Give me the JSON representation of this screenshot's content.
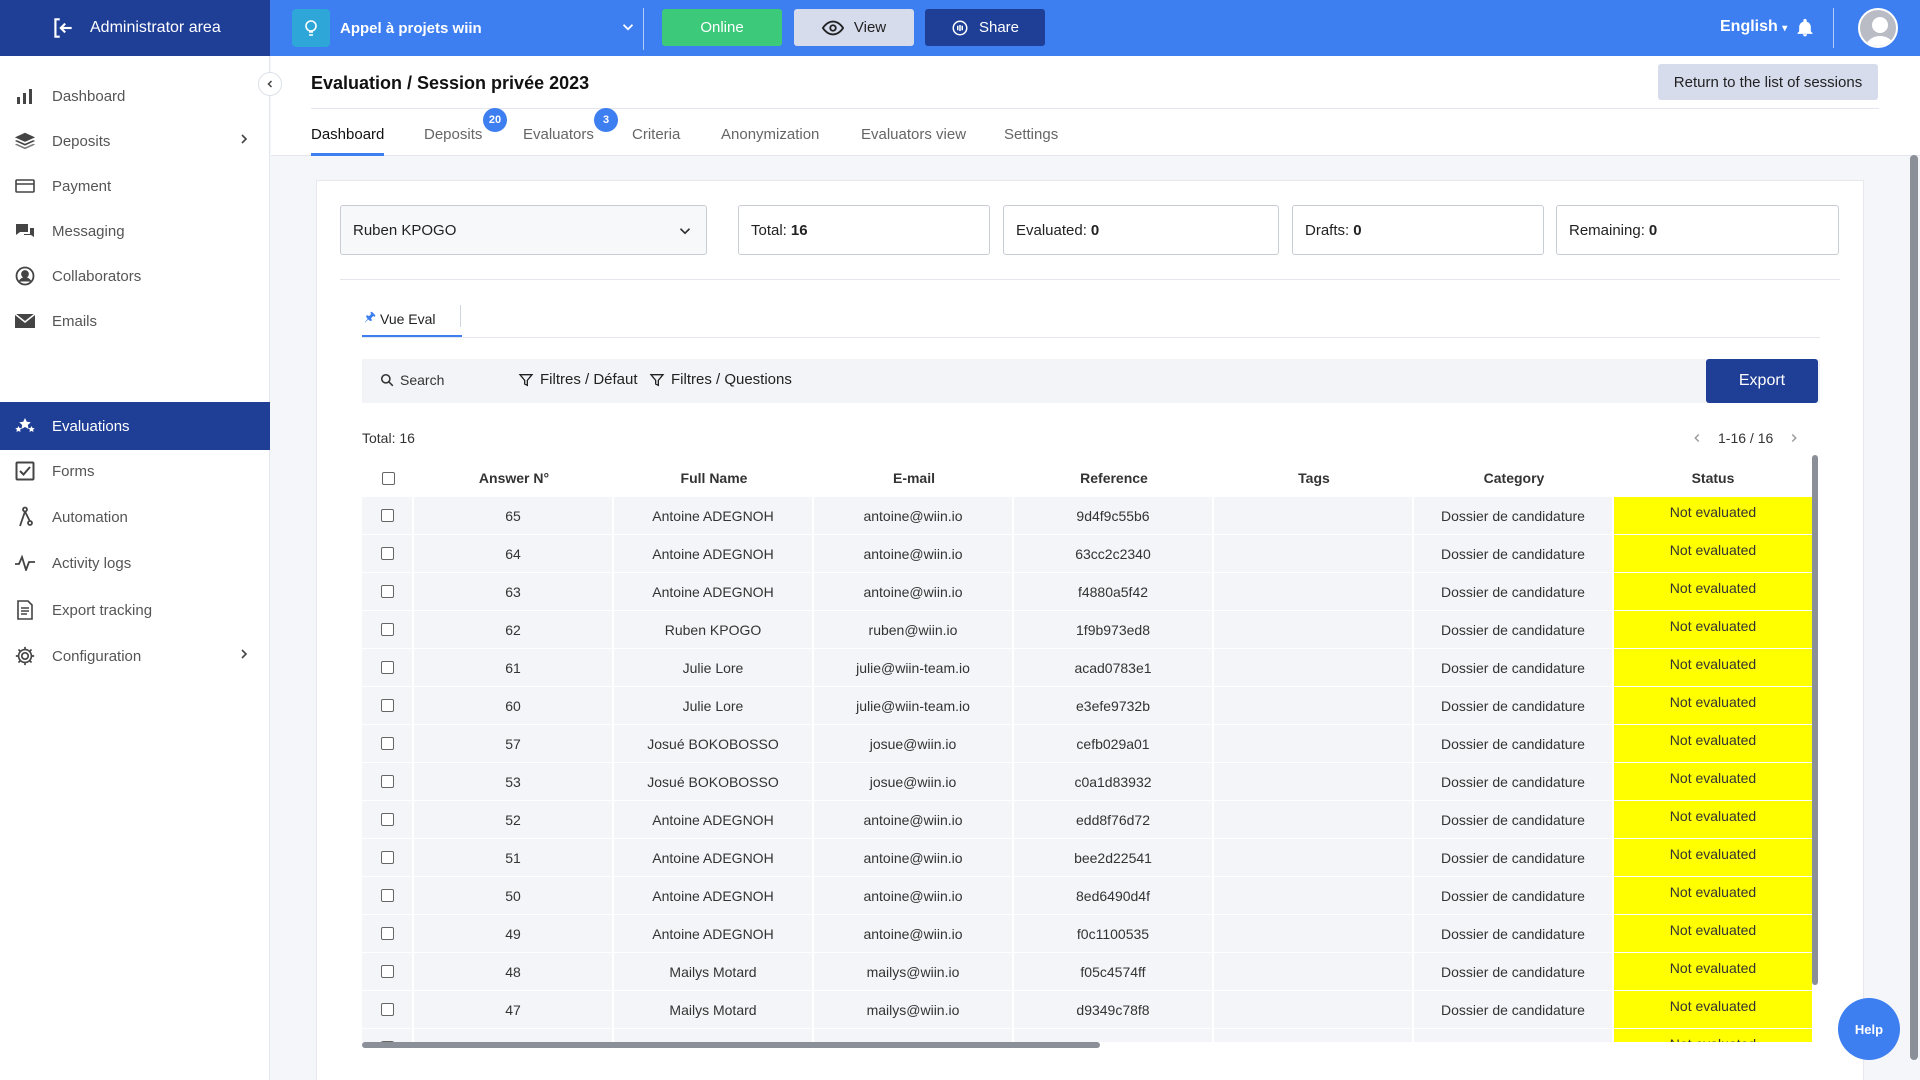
{
  "topbar": {
    "admin_label": "Administrator area",
    "project_name": "Appel à projets wiin",
    "online_label": "Online",
    "view_label": "View",
    "share_label": "Share",
    "language": "English",
    "brand_color": "#3d7ef0",
    "dark_color": "#1f3f96"
  },
  "sidebar": {
    "items": [
      {
        "label": "Dashboard",
        "icon": "bar-chart-icon"
      },
      {
        "label": "Deposits",
        "icon": "layers-icon"
      },
      {
        "label": "Payment",
        "icon": "card-icon"
      },
      {
        "label": "Messaging",
        "icon": "chat-icon"
      },
      {
        "label": "Collaborators",
        "icon": "user-circle-icon"
      },
      {
        "label": "Emails",
        "icon": "envelope-icon"
      },
      {
        "label": "Evaluations",
        "icon": "stars-icon"
      },
      {
        "label": "Forms",
        "icon": "checkbox-icon"
      },
      {
        "label": "Automation",
        "icon": "automation-icon"
      },
      {
        "label": "Activity logs",
        "icon": "pulse-icon"
      },
      {
        "label": "Export tracking",
        "icon": "document-icon"
      },
      {
        "label": "Configuration",
        "icon": "gear-icon"
      }
    ]
  },
  "header": {
    "title": "Evaluation / Session privée 2023",
    "return_label": "Return to the list of sessions",
    "tabs": [
      {
        "label": "Dashboard"
      },
      {
        "label": "Deposits",
        "badge": "20"
      },
      {
        "label": "Evaluators",
        "badge": "3"
      },
      {
        "label": "Criteria"
      },
      {
        "label": "Anonymization"
      },
      {
        "label": "Evaluators view"
      },
      {
        "label": "Settings"
      }
    ]
  },
  "filters": {
    "evaluator": "Ruben KPOGO",
    "stats": [
      {
        "label": "Total:",
        "value": "16"
      },
      {
        "label": "Evaluated:",
        "value": "0"
      },
      {
        "label": "Drafts:",
        "value": "0"
      },
      {
        "label": "Remaining:",
        "value": "0"
      }
    ]
  },
  "subtab": {
    "label": "Vue Eval"
  },
  "toolbar": {
    "search_label": "Search",
    "filter_default": "Filtres / Défaut",
    "filter_questions": "Filtres / Questions",
    "export_label": "Export"
  },
  "list": {
    "total_label": "Total: 16",
    "pager": "1-16 / 16",
    "columns": [
      "Answer N°",
      "Full Name",
      "E-mail",
      "Reference",
      "Tags",
      "Category",
      "Status"
    ],
    "rows": [
      {
        "n": "65",
        "name": "Antoine ADEGNOH",
        "email": "antoine@wiin.io",
        "ref": "9d4f9c55b6",
        "tags": "",
        "cat": "Dossier de candidature",
        "status": "Not evaluated"
      },
      {
        "n": "64",
        "name": "Antoine ADEGNOH",
        "email": "antoine@wiin.io",
        "ref": "63cc2c2340",
        "tags": "",
        "cat": "Dossier de candidature",
        "status": "Not evaluated"
      },
      {
        "n": "63",
        "name": "Antoine ADEGNOH",
        "email": "antoine@wiin.io",
        "ref": "f4880a5f42",
        "tags": "",
        "cat": "Dossier de candidature",
        "status": "Not evaluated"
      },
      {
        "n": "62",
        "name": "Ruben KPOGO",
        "email": "ruben@wiin.io",
        "ref": "1f9b973ed8",
        "tags": "",
        "cat": "Dossier de candidature",
        "status": "Not evaluated"
      },
      {
        "n": "61",
        "name": "Julie Lore",
        "email": "julie@wiin-team.io",
        "ref": "acad0783e1",
        "tags": "",
        "cat": "Dossier de candidature",
        "status": "Not evaluated"
      },
      {
        "n": "60",
        "name": "Julie Lore",
        "email": "julie@wiin-team.io",
        "ref": "e3efe9732b",
        "tags": "",
        "cat": "Dossier de candidature",
        "status": "Not evaluated"
      },
      {
        "n": "57",
        "name": "Josué BOKOBOSSO",
        "email": "josue@wiin.io",
        "ref": "cefb029a01",
        "tags": "",
        "cat": "Dossier de candidature",
        "status": "Not evaluated"
      },
      {
        "n": "53",
        "name": "Josué BOKOBOSSO",
        "email": "josue@wiin.io",
        "ref": "c0a1d83932",
        "tags": "",
        "cat": "Dossier de candidature",
        "status": "Not evaluated"
      },
      {
        "n": "52",
        "name": "Antoine ADEGNOH",
        "email": "antoine@wiin.io",
        "ref": "edd8f76d72",
        "tags": "",
        "cat": "Dossier de candidature",
        "status": "Not evaluated"
      },
      {
        "n": "51",
        "name": "Antoine ADEGNOH",
        "email": "antoine@wiin.io",
        "ref": "bee2d22541",
        "tags": "",
        "cat": "Dossier de candidature",
        "status": "Not evaluated"
      },
      {
        "n": "50",
        "name": "Antoine ADEGNOH",
        "email": "antoine@wiin.io",
        "ref": "8ed6490d4f",
        "tags": "",
        "cat": "Dossier de candidature",
        "status": "Not evaluated"
      },
      {
        "n": "49",
        "name": "Antoine ADEGNOH",
        "email": "antoine@wiin.io",
        "ref": "f0c1100535",
        "tags": "",
        "cat": "Dossier de candidature",
        "status": "Not evaluated"
      },
      {
        "n": "48",
        "name": "Mailys Motard",
        "email": "mailys@wiin.io",
        "ref": "f05c4574ff",
        "tags": "",
        "cat": "Dossier de candidature",
        "status": "Not evaluated"
      },
      {
        "n": "47",
        "name": "Mailys Motard",
        "email": "mailys@wiin.io",
        "ref": "d9349c78f8",
        "tags": "",
        "cat": "Dossier de candidature",
        "status": "Not evaluated"
      },
      {
        "n": "",
        "name": "",
        "email": "",
        "ref": "",
        "tags": "",
        "cat": "",
        "status": "Not evaluated"
      }
    ]
  },
  "help_label": "Help"
}
